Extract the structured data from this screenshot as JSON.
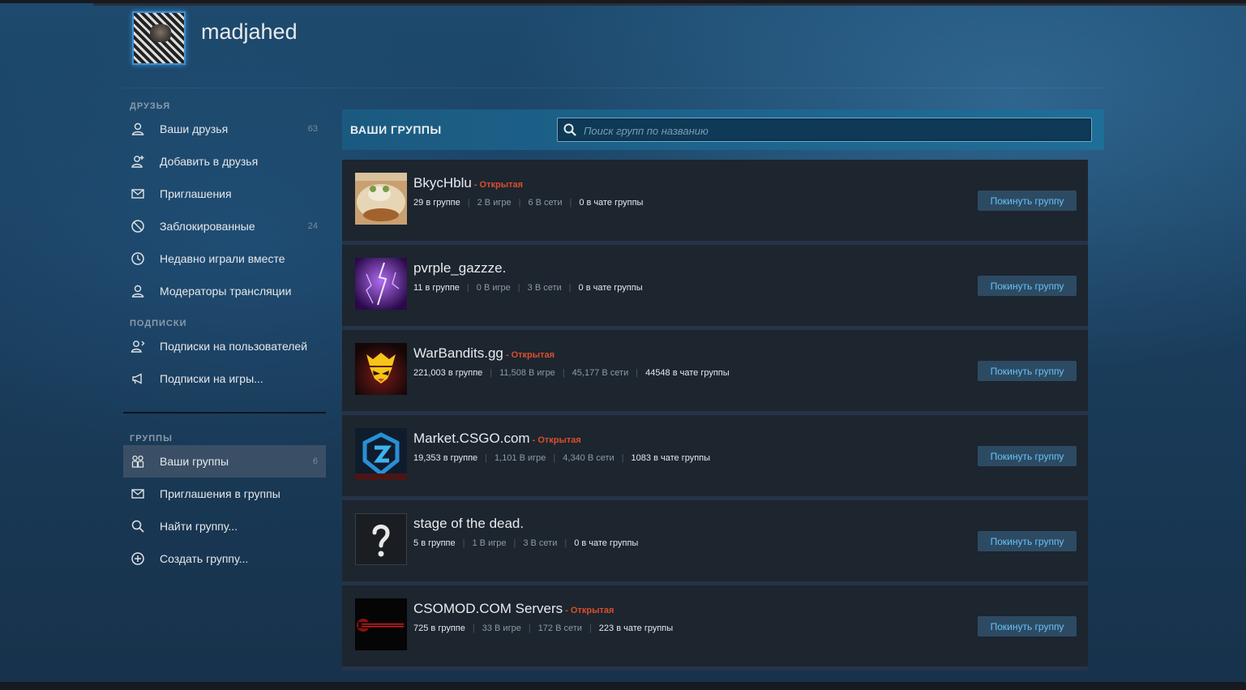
{
  "profile": {
    "username": "madjahed"
  },
  "sidebar": {
    "friends_section": "ДРУЗЬЯ",
    "friends_items": [
      {
        "label": "Ваши друзья",
        "count": "63",
        "icon": "person-icon"
      },
      {
        "label": "Добавить в друзья",
        "count": "",
        "icon": "add-friend-icon"
      },
      {
        "label": "Приглашения",
        "count": "",
        "icon": "envelope-icon"
      },
      {
        "label": "Заблокированные",
        "count": "24",
        "icon": "blocked-icon"
      },
      {
        "label": "Недавно играли вместе",
        "count": "",
        "icon": "clock-icon"
      },
      {
        "label": "Модераторы трансляции",
        "count": "",
        "icon": "person-icon"
      }
    ],
    "subs_section": "ПОДПИСКИ",
    "subs_items": [
      {
        "label": "Подписки на пользователей",
        "icon": "follow-user-icon"
      },
      {
        "label": "Подписки на игры...",
        "icon": "megaphone-icon"
      }
    ],
    "groups_section": "ГРУППЫ",
    "groups_items": [
      {
        "label": "Ваши группы",
        "count": "6",
        "icon": "group-icon",
        "active": true
      },
      {
        "label": "Приглашения в группы",
        "count": "",
        "icon": "envelope-icon"
      },
      {
        "label": "Найти группу...",
        "count": "",
        "icon": "search-icon"
      },
      {
        "label": "Создать группу...",
        "count": "",
        "icon": "plus-circle-icon"
      }
    ]
  },
  "groups_panel": {
    "title": "ВАШИ ГРУППЫ",
    "search_placeholder": "Поиск групп по названию",
    "search_value": "",
    "leave_label": "Покинуть группу",
    "open_label": "- Открытая",
    "in_group_suffix": "в группе",
    "in_game_suffix": "В игре",
    "online_suffix": "В сети",
    "in_chat_suffix": "в чате группы"
  },
  "groups": [
    {
      "name": "BkycHblu",
      "open": true,
      "members": "29",
      "in_game": "2",
      "online": "6",
      "in_chat": "0",
      "avatar": "food-avatar"
    },
    {
      "name": "pvrple_gazzze.",
      "open": false,
      "members": "11",
      "in_game": "0",
      "online": "3",
      "in_chat": "0",
      "avatar": "purple-lightning-avatar"
    },
    {
      "name": "WarBandits.gg",
      "open": true,
      "members": "221,003",
      "in_game": "11,508",
      "online": "45,177",
      "in_chat": "44548",
      "avatar": "warbandits-logo-avatar"
    },
    {
      "name": "Market.CSGO.com",
      "open": true,
      "members": "19,353",
      "in_game": "1,101",
      "online": "4,340",
      "in_chat": "1083",
      "avatar": "market-csgo-logo-avatar"
    },
    {
      "name": "stage of the dead.",
      "open": false,
      "members": "5",
      "in_game": "1",
      "online": "3",
      "in_chat": "0",
      "avatar": "question-mark-avatar"
    },
    {
      "name": "CSOMOD.COM Servers",
      "open": true,
      "members": "725",
      "in_game": "33",
      "online": "172",
      "in_chat": "223",
      "avatar": "csomod-logo-avatar"
    }
  ],
  "colors": {
    "open_badge": "#d94f2b",
    "leave_button_text": "#67c1f5",
    "header_accent": "#1f6e98"
  }
}
